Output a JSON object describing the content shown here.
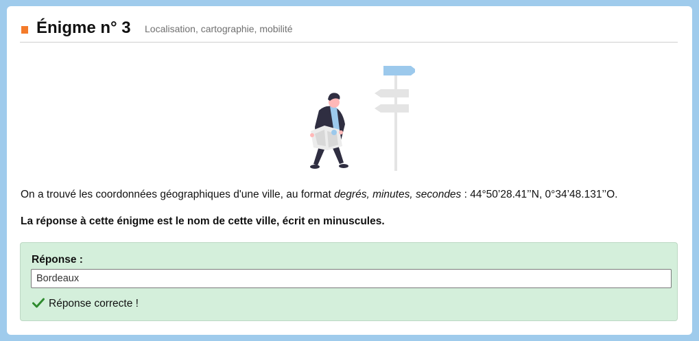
{
  "header": {
    "title": "Énigme n° 3",
    "subtitle": "Localisation, cartographie, mobilité",
    "accent_color": "#f47b2a"
  },
  "illustration": {
    "icon": "person-with-map-signpost-illustration"
  },
  "content": {
    "intro_prefix": "On a trouvé les coordonnées géographiques d'une ville, au format ",
    "intro_format": "degrés, minutes, secondes",
    "intro_suffix": " : 44°50’28.41’’N, 0°34’48.131’’O.",
    "instruction": "La réponse à cette énigme est le nom de cette ville, écrit en minuscules."
  },
  "answer": {
    "label": "Réponse :",
    "value": "Bordeaux",
    "status_text": "Réponse correcte !",
    "status_icon": "checkmark-icon",
    "box_color": "#d4efdb",
    "check_color": "#2e8b2e"
  }
}
